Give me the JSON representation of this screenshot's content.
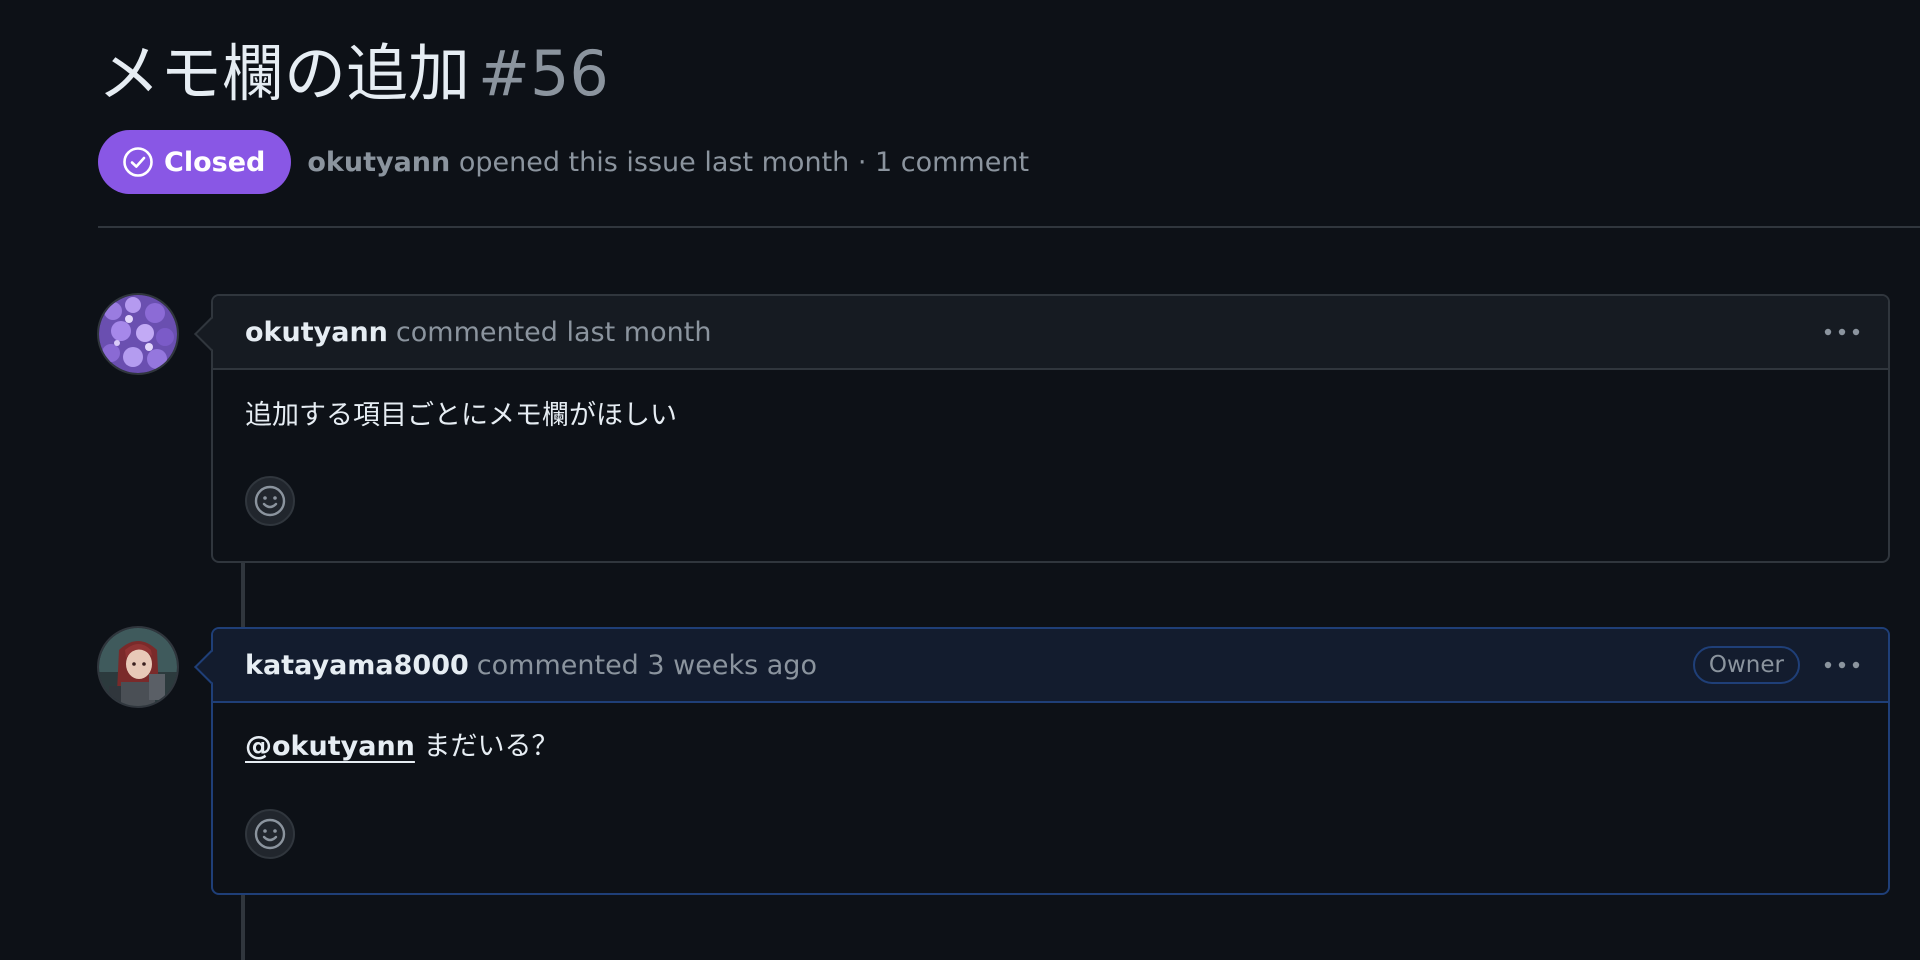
{
  "issue": {
    "title": "メモ欄の追加",
    "number": "#56",
    "state": "Closed",
    "author": "okutyann",
    "summary": "opened this issue last month · 1 comment"
  },
  "comments": [
    {
      "author": "okutyann",
      "meta": "commented last month",
      "body": "追加する項目ごとにメモ欄がほしい",
      "role": ""
    },
    {
      "author": "katayama8000",
      "meta": "commented 3 weeks ago",
      "role": "Owner",
      "mention": "@okutyann",
      "body": "まだいる？"
    }
  ],
  "colors": {
    "background": "#0d1117",
    "closed_badge": "#8957e5",
    "border": "#30363d",
    "owner_border": "#1f3f78"
  },
  "icons": {
    "state": "check-circle-icon",
    "menu": "kebab-horizontal-icon",
    "reaction": "smiley-icon"
  }
}
